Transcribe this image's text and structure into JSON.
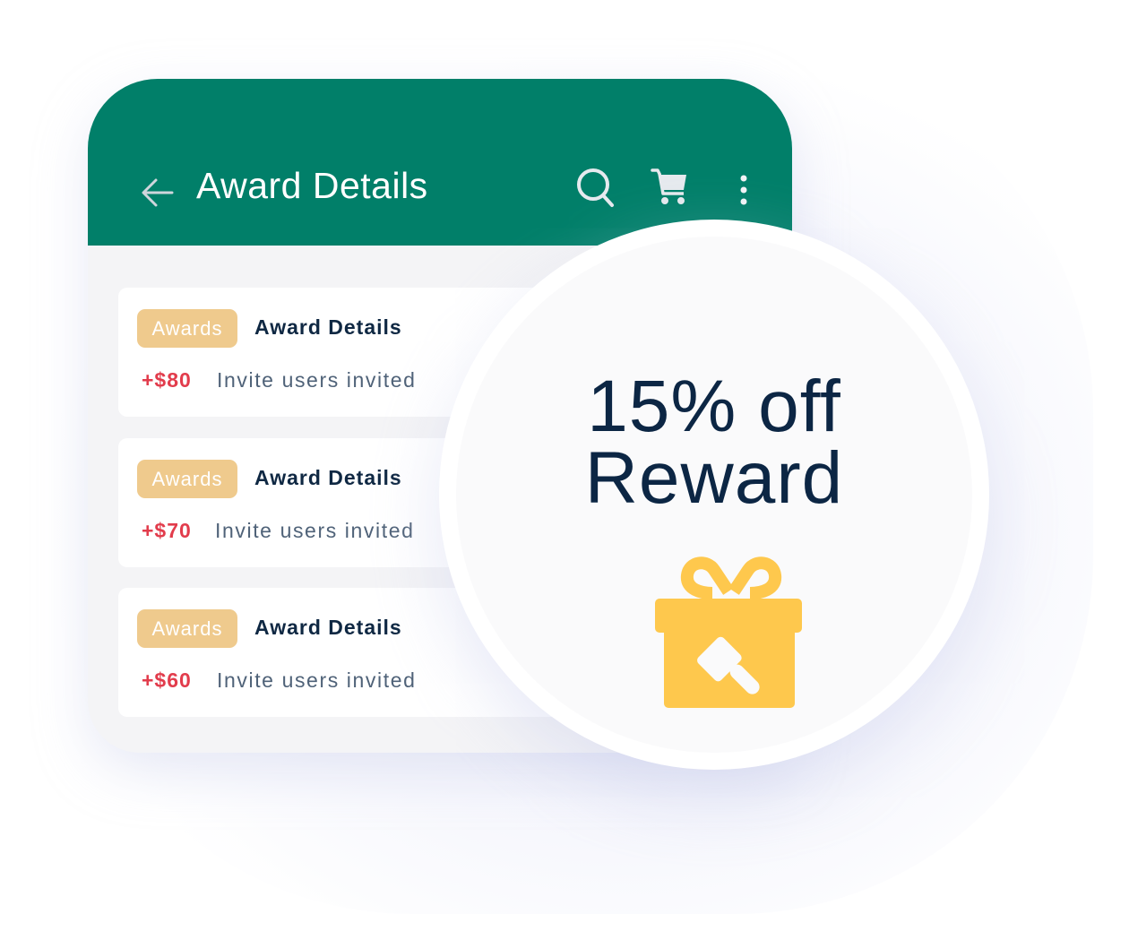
{
  "app_bar": {
    "title": "Award Details",
    "icons": {
      "back": "arrow-left-icon",
      "search": "search-icon",
      "cart": "cart-icon",
      "more": "more-vertical-icon"
    },
    "background_color": "#017f69"
  },
  "awards": [
    {
      "badge": "Awards",
      "title": "Award Details",
      "amount": "+$80",
      "description": "Invite users invited"
    },
    {
      "badge": "Awards",
      "title": "Award Details",
      "amount": "+$70",
      "description": "Invite users invited"
    },
    {
      "badge": "Awards",
      "title": "Award Details",
      "amount": "+$60",
      "description": "Invite users invited"
    }
  ],
  "promo": {
    "line1": "15% off",
    "line2": "Reward",
    "icon": "gift-icon",
    "icon_color": "#fec84d"
  },
  "colors": {
    "badge": "#efca8d",
    "amount": "#e23c4c",
    "title": "#0f2843"
  }
}
